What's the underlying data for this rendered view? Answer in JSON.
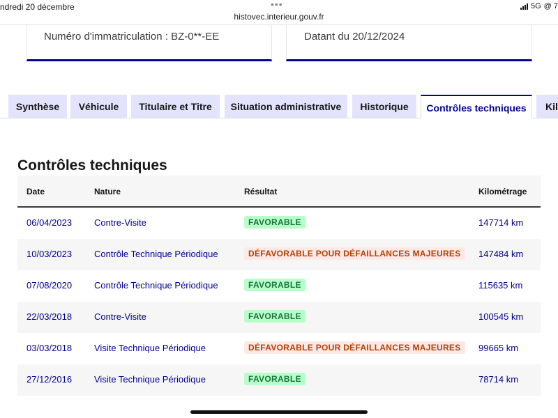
{
  "status_bar": {
    "date": "ndredi 20 décembre",
    "dots": "•••",
    "url": "histovec.interieur.gouv.fr",
    "network": "5G",
    "extra": "@ 7"
  },
  "cards": {
    "plate": "Numéro d'immatriculation : BZ-0**-EE",
    "date": "Datant du 20/12/2024"
  },
  "tabs": [
    {
      "label": "Synthèse",
      "active": false
    },
    {
      "label": "Véhicule",
      "active": false
    },
    {
      "label": "Titulaire et Titre",
      "active": false
    },
    {
      "label": "Situation administrative",
      "active": false
    },
    {
      "label": "Historique",
      "active": false
    },
    {
      "label": "Contrôles techniques",
      "active": true
    },
    {
      "label": "Kilo",
      "active": false
    }
  ],
  "section": {
    "title": "Contrôles techniques"
  },
  "table": {
    "headers": {
      "date": "Date",
      "nature": "Nature",
      "result": "Résultat",
      "km": "Kilométrage"
    },
    "rows": [
      {
        "date": "06/04/2023",
        "nature": "Contre-Visite",
        "result": "FAVORABLE",
        "status": "ok",
        "km": "147714 km"
      },
      {
        "date": "10/03/2023",
        "nature": "Contrôle Technique Périodique",
        "result": "DÉFAVORABLE POUR DÉFAILLANCES MAJEURES",
        "status": "ko",
        "km": "147484 km"
      },
      {
        "date": "07/08/2020",
        "nature": "Contrôle Technique Périodique",
        "result": "FAVORABLE",
        "status": "ok",
        "km": "115635 km"
      },
      {
        "date": "22/03/2018",
        "nature": "Contre-Visite",
        "result": "FAVORABLE",
        "status": "ok",
        "km": "100545 km"
      },
      {
        "date": "03/03/2018",
        "nature": "Visite Technique Périodique",
        "result": "DÉFAVORABLE POUR DÉFAILLANCES MAJEURES",
        "status": "ko",
        "km": "99665 km"
      },
      {
        "date": "27/12/2016",
        "nature": "Visite Technique Périodique",
        "result": "FAVORABLE",
        "status": "ok",
        "km": "78714 km"
      }
    ]
  },
  "colors": {
    "accent": "#000091",
    "tab_bg": "#e3e3fd",
    "favorable_bg": "#b8fec9",
    "favorable_text": "#18753c",
    "defavorable_bg": "#ffe9e6",
    "defavorable_text": "#b34000"
  }
}
